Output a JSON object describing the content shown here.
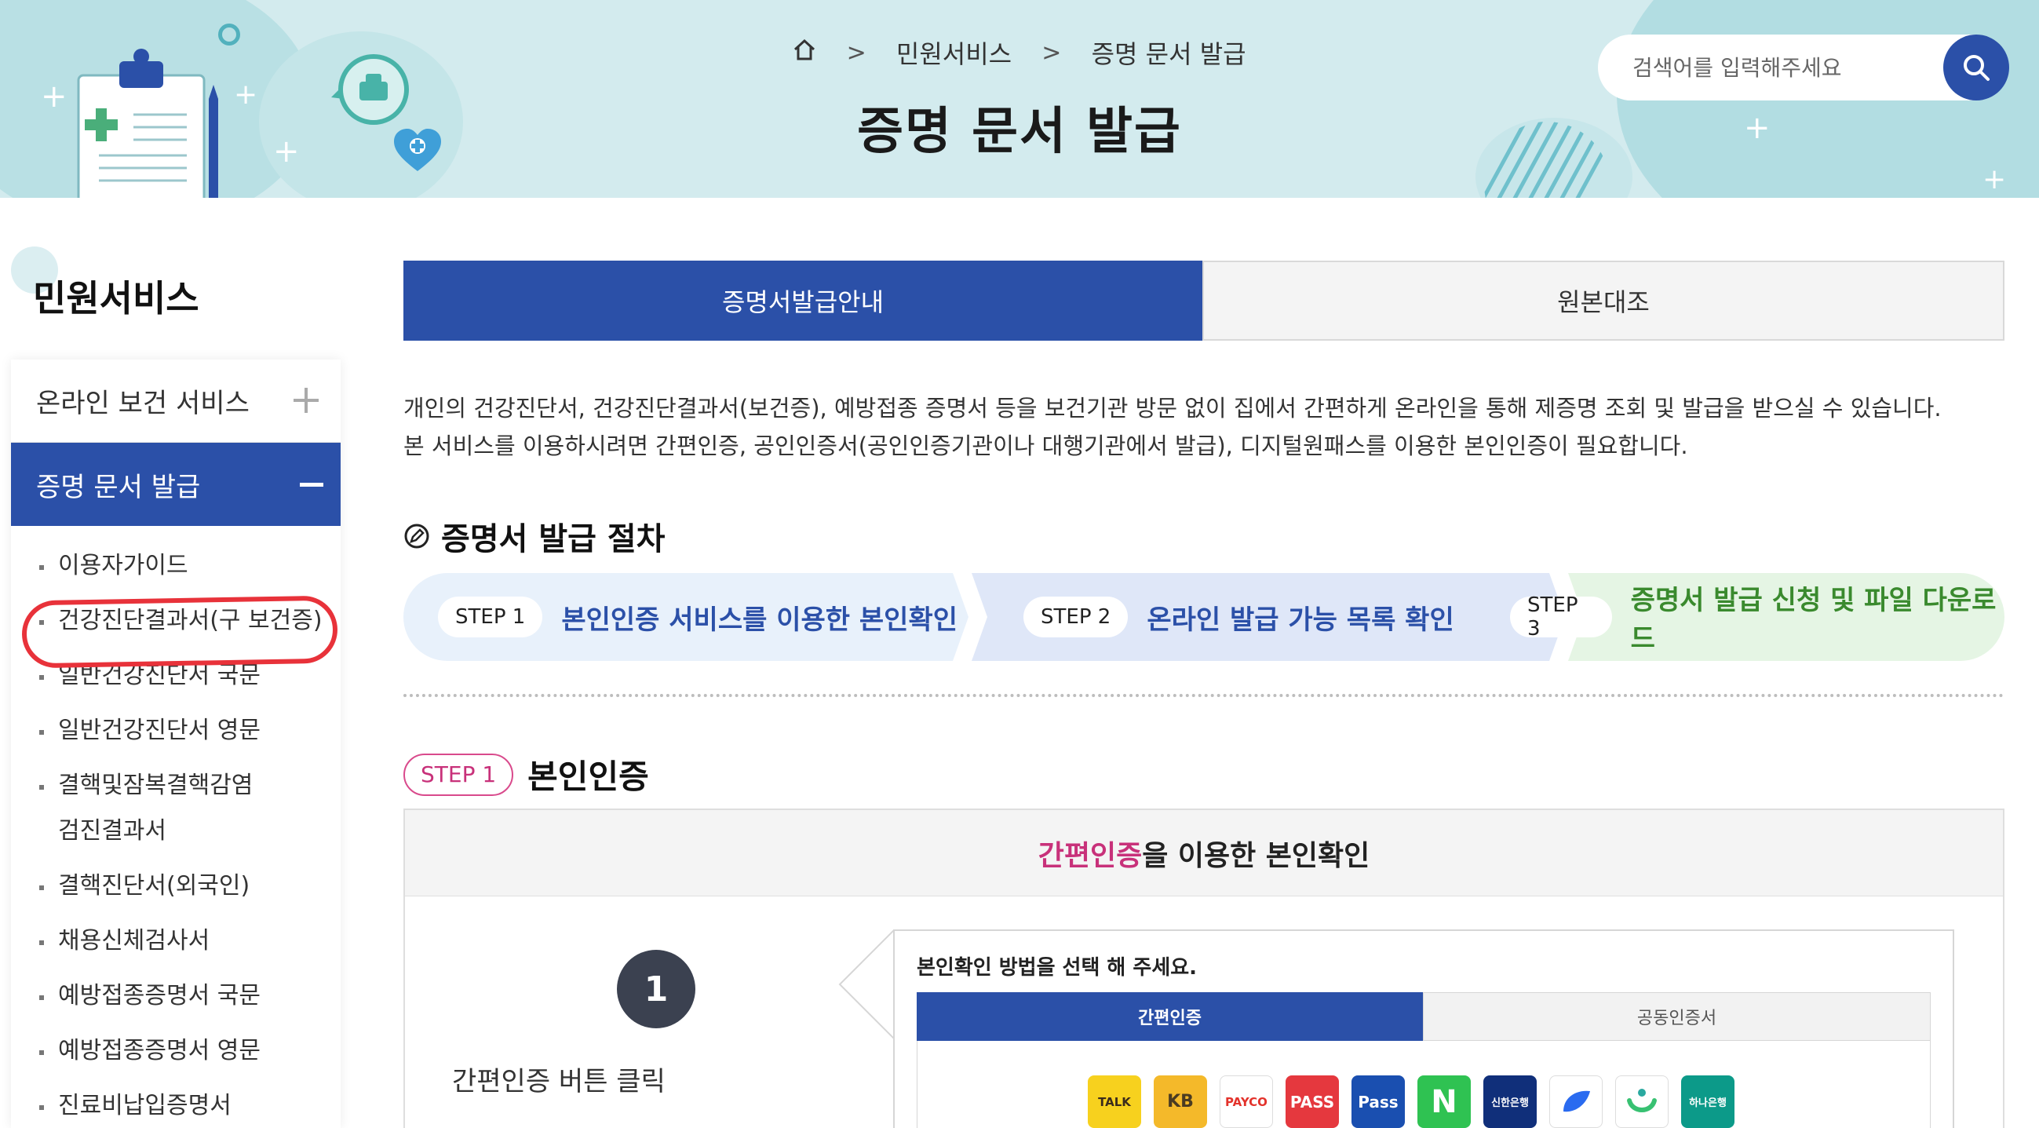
{
  "header": {
    "breadcrumb": {
      "section": "민원서비스",
      "current": "증명 문서 발급"
    },
    "title": "증명 문서 발급",
    "search": {
      "placeholder": "검색어를 입력해주세요"
    }
  },
  "sidebar": {
    "title": "민원서비스",
    "menu": [
      {
        "label": "온라인 보건 서비스",
        "state": "collapsed"
      },
      {
        "label": "증명 문서 발급",
        "state": "expanded"
      }
    ],
    "sub_items": [
      "이용자가이드",
      "건강진단결과서(구 보건증)",
      "일반건강진단서 국문",
      "일반건강진단서 영문",
      "결핵및잠복결핵감염",
      "검진결과서",
      "결핵진단서(외국인)",
      "채용신체검사서",
      "예방접종증명서 국문",
      "예방접종증명서 영문",
      "진료비납입증명서"
    ]
  },
  "tabs": {
    "active": "증명서발급안내",
    "inactive": "원본대조"
  },
  "intro": {
    "line1": "개인의 건강진단서, 건강진단결과서(보건증), 예방접종 증명서 등을 보건기관 방문 없이 집에서 간편하게 온라인을 통해 제증명 조회 및 발급을 받으실 수 있습니다.",
    "line2": "본 서비스를 이용하시려면 간편인증, 공인인증서(공인인증기관이나 대행기관에서 발급), 디지털원패스를 이용한 본인인증이 필요합니다."
  },
  "procedure": {
    "title": "증명서 발급 절차",
    "steps": [
      {
        "badge": "STEP 1",
        "text": "본인인증 서비스를 이용한 본인확인"
      },
      {
        "badge": "STEP 2",
        "text": "온라인 발급 가능 목록 확인"
      },
      {
        "badge": "STEP 3",
        "text": "증명서 발급 신청 및 파일 다운로드"
      }
    ]
  },
  "step1": {
    "badge": "STEP 1",
    "title": "본인인증",
    "box_title_highlight": "간편인증",
    "box_title_rest": "을 이용한 본인확인",
    "number": "1",
    "caption": "간편인증 버튼 클릭",
    "card": {
      "title": "본인확인 방법을 선택 해 주세요.",
      "tab_active": "간편인증",
      "tab_inactive": "공동인증서",
      "providers": [
        "TALK",
        "KB",
        "PAYCO",
        "PASS",
        "Pass",
        "N",
        "신한은행",
        "",
        "",
        "하나은행"
      ]
    }
  },
  "colors": {
    "brand_blue": "#2b50a8",
    "banner_bg": "#d3ebee",
    "pink": "#c8317a",
    "green_text": "#3a8a2e"
  }
}
